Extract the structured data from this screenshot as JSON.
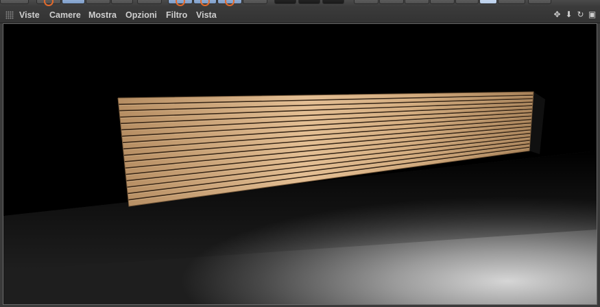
{
  "menu": {
    "items": [
      {
        "id": "viste",
        "label": "Viste"
      },
      {
        "id": "camere",
        "label": "Camere"
      },
      {
        "id": "mostra",
        "label": "Mostra"
      },
      {
        "id": "opzioni",
        "label": "Opzioni"
      },
      {
        "id": "filtro",
        "label": "Filtro"
      },
      {
        "id": "vista",
        "label": "Vista"
      }
    ]
  },
  "nav_icons": [
    {
      "name": "move-view-icon",
      "glyph": "✥"
    },
    {
      "name": "dolly-view-icon",
      "glyph": "⬇"
    },
    {
      "name": "rotate-view-icon",
      "glyph": "↻"
    },
    {
      "name": "toggle-layout-icon",
      "glyph": "▣"
    }
  ],
  "toolbar_icons": [
    "undo-icon",
    "render-region-icon",
    "render-icon",
    "live-select-icon",
    "move-icon",
    "scale-icon",
    "rotate-icon",
    "play-icon",
    "record-icon",
    "keyframe-icon",
    "camera-icon",
    "light-icon",
    "deformer-icon",
    "sky-icon",
    "floor-icon",
    "scene-icon"
  ],
  "scene": {
    "panel_color": "#c8a074",
    "slat_count": 16
  }
}
